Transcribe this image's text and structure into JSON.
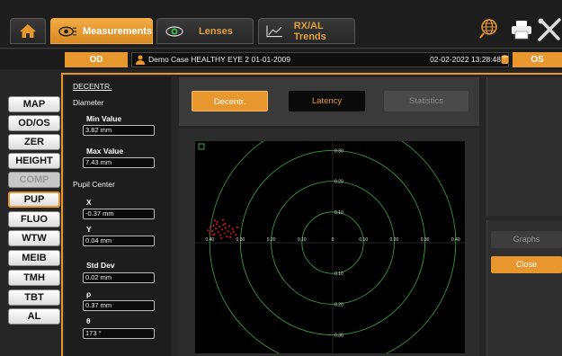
{
  "toolbar": {
    "tabs": [
      {
        "label": "Measurements",
        "active": true
      },
      {
        "label": "Lenses",
        "active": false
      },
      {
        "label": "RX/AL Trends",
        "active": false
      }
    ],
    "icons": [
      "home-icon",
      "globe-icon",
      "printer-icon",
      "tools-icon"
    ]
  },
  "patient_bar": {
    "od_label": "OD",
    "os_label": "OS",
    "patient_name": "Demo Case HEALTHY EYE 2 01-01-2009",
    "exam_datetime": "02-02-2022 13:28:48"
  },
  "nav": [
    {
      "label": "MAP",
      "state": "normal"
    },
    {
      "label": "OD/OS",
      "state": "normal"
    },
    {
      "label": "ZER",
      "state": "normal"
    },
    {
      "label": "HEIGHT",
      "state": "normal"
    },
    {
      "label": "COMP",
      "state": "disabled"
    },
    {
      "label": "PUP",
      "state": "active"
    },
    {
      "label": "FLUO",
      "state": "normal"
    },
    {
      "label": "WTW",
      "state": "normal"
    },
    {
      "label": "MEIB",
      "state": "normal"
    },
    {
      "label": "TMH",
      "state": "normal"
    },
    {
      "label": "TBT",
      "state": "normal"
    },
    {
      "label": "AL",
      "state": "normal"
    }
  ],
  "panel": {
    "title": "DECENTR.",
    "diameter_heading": "Diameter",
    "min_label": "Min Value",
    "min_value": "3.82 mm",
    "max_label": "Max Value",
    "max_value": "7.43 mm",
    "center_heading": "Pupil Center",
    "x_label": "X",
    "x_value": "-0.37 mm",
    "y_label": "Y",
    "y_value": "0.04 mm",
    "std_label": "Std Dev",
    "std_value": "0.02 mm",
    "rho_label": "ρ",
    "rho_value": "0.37 mm",
    "theta_label": "θ",
    "theta_value": "173 °"
  },
  "analysis_tabs": {
    "decentr": "Decentr.",
    "latency": "Latency",
    "statistics": "Statistics"
  },
  "actions": {
    "graphs": "Graphs",
    "close": "Close"
  },
  "colors": {
    "accent": "#e8962e",
    "plot_circle": "#3aa838",
    "scatter": "#e0141e"
  },
  "chart_data": {
    "type": "scatter",
    "ring_radii": [
      0.1,
      0.2,
      0.3,
      0.4
    ],
    "x_tick_labels": [
      "0.40",
      "0.30",
      "0.20",
      "0.10",
      "0",
      "0.10",
      "0.20",
      "0.30",
      "0.40"
    ],
    "y_tick_labels": [
      "0.40",
      "0.30",
      "0.20",
      "0.10",
      "0.10",
      "0.20",
      "0.30",
      "0.40"
    ],
    "xlim": [
      -0.4,
      0.4
    ],
    "ylim": [
      -0.4,
      0.4
    ],
    "points": [
      [
        -0.405,
        0.04
      ],
      [
        -0.398,
        0.05
      ],
      [
        -0.392,
        0.038
      ],
      [
        -0.388,
        0.055
      ],
      [
        -0.385,
        0.028
      ],
      [
        -0.38,
        0.046
      ],
      [
        -0.378,
        0.06
      ],
      [
        -0.372,
        0.035
      ],
      [
        -0.368,
        0.052
      ],
      [
        -0.365,
        0.025
      ],
      [
        -0.36,
        0.043
      ],
      [
        -0.356,
        0.058
      ],
      [
        -0.352,
        0.031
      ],
      [
        -0.348,
        0.048
      ],
      [
        -0.344,
        0.02
      ],
      [
        -0.34,
        0.037
      ],
      [
        -0.336,
        0.054
      ],
      [
        -0.33,
        0.03
      ],
      [
        -0.325,
        0.045
      ],
      [
        -0.39,
        0.025
      ],
      [
        -0.375,
        0.068
      ],
      [
        -0.362,
        0.015
      ],
      [
        -0.35,
        0.062
      ],
      [
        -0.333,
        0.018
      ],
      [
        -0.322,
        0.036
      ],
      [
        -0.315,
        0.026
      ],
      [
        -0.31,
        0.05
      ],
      [
        -0.383,
        0.072
      ],
      [
        -0.357,
        0.074
      ],
      [
        -0.4,
        0.03
      ]
    ]
  }
}
